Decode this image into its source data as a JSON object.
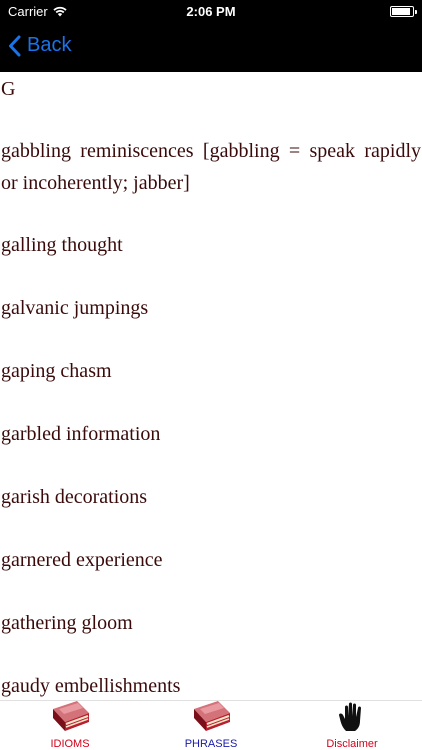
{
  "status": {
    "carrier": "Carrier",
    "time": "2:06 PM"
  },
  "nav": {
    "back_label": "Back"
  },
  "content": {
    "letter": "G",
    "entries": [
      "gabbling reminiscences  [gabbling = speak rapidly or incoherently; jabber]",
      "galling thought",
      "galvanic jumpings",
      "gaping chasm",
      "garbled information",
      "garish decorations",
      "garnered experience",
      "gathering gloom",
      "gaudy embellishments"
    ]
  },
  "tabs": {
    "idioms": {
      "label": "IDIOMS",
      "color": "#d0021b",
      "icon": "book-icon"
    },
    "phrases": {
      "label": "PHRASES",
      "color": "#1a1aa8",
      "icon": "book-icon"
    },
    "disclaimer": {
      "label": "Disclaimer",
      "color": "#d0021b",
      "icon": "hand-icon"
    }
  },
  "colors": {
    "text": "#3a0a0a",
    "accent": "#1a73e8",
    "bar": "#000000"
  }
}
